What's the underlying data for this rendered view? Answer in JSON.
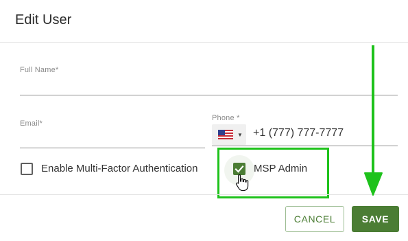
{
  "dialog": {
    "title": "Edit User"
  },
  "form": {
    "full_name": {
      "label": "Full Name",
      "required_mark": "*",
      "value": ""
    },
    "email": {
      "label": "Email",
      "required_mark": "*",
      "value": ""
    },
    "phone": {
      "label": "Phone",
      "required_mark": "*",
      "country": "United States",
      "value": "+1 (777) 777-7777"
    },
    "mfa": {
      "label": "Enable Multi-Factor Authentication",
      "checked": false
    },
    "msp_admin": {
      "label": "MSP Admin",
      "checked": true
    }
  },
  "buttons": {
    "cancel_label": "CANCEL",
    "save_label": "SAVE"
  },
  "colors": {
    "accent": "#4b7d34",
    "annotation": "#1ec21b"
  },
  "icons": {
    "flag": "us-flag-icon",
    "caret": "caret-down-icon",
    "check": "checkmark-icon",
    "cursor": "hand-pointer-icon",
    "arrow": "down-arrow-icon"
  }
}
